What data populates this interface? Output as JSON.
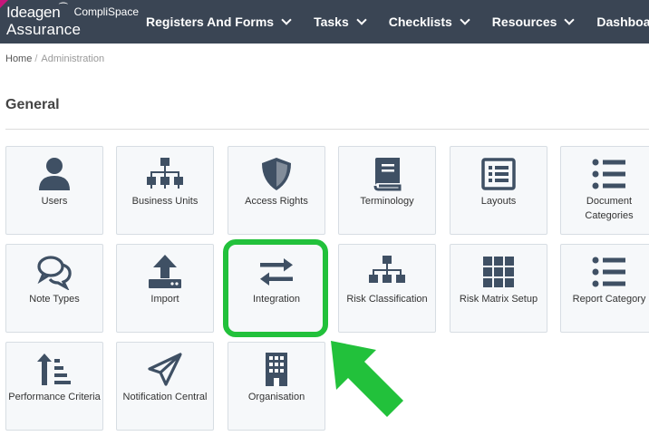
{
  "header": {
    "brand": "Ideagen",
    "brand_sub": "CompliSpace",
    "product": "Assurance",
    "nav": [
      {
        "label": "Registers And Forms"
      },
      {
        "label": "Tasks"
      },
      {
        "label": "Checklists"
      },
      {
        "label": "Resources"
      },
      {
        "label": "Dashboards"
      }
    ]
  },
  "breadcrumb": {
    "home": "Home",
    "separator": "/",
    "current": "Administration"
  },
  "section": {
    "title": "General"
  },
  "colors": {
    "topbar": "#3a4554",
    "icon": "#3f5064",
    "highlight": "#22c13b",
    "brand_accent": "#c7167a"
  },
  "tiles": [
    {
      "label": "Users",
      "icon": "user-icon"
    },
    {
      "label": "Business Units",
      "icon": "org-chart-icon"
    },
    {
      "label": "Access Rights",
      "icon": "shield-icon"
    },
    {
      "label": "Terminology",
      "icon": "book-icon"
    },
    {
      "label": "Layouts",
      "icon": "list-alt-icon"
    },
    {
      "label": "Document Categories",
      "icon": "list-icon"
    },
    {
      "label": "Note Types",
      "icon": "comments-icon"
    },
    {
      "label": "Import",
      "icon": "upload-icon"
    },
    {
      "label": "Integration",
      "icon": "exchange-icon"
    },
    {
      "label": "Risk Classification",
      "icon": "sitemap-icon"
    },
    {
      "label": "Risk Matrix Setup",
      "icon": "grid-icon"
    },
    {
      "label": "Report Category",
      "icon": "list-icon"
    },
    {
      "label": "Performance Criteria",
      "icon": "sort-amount-icon"
    },
    {
      "label": "Notification Central",
      "icon": "paper-plane-icon"
    },
    {
      "label": "Organisation",
      "icon": "building-icon"
    }
  ]
}
